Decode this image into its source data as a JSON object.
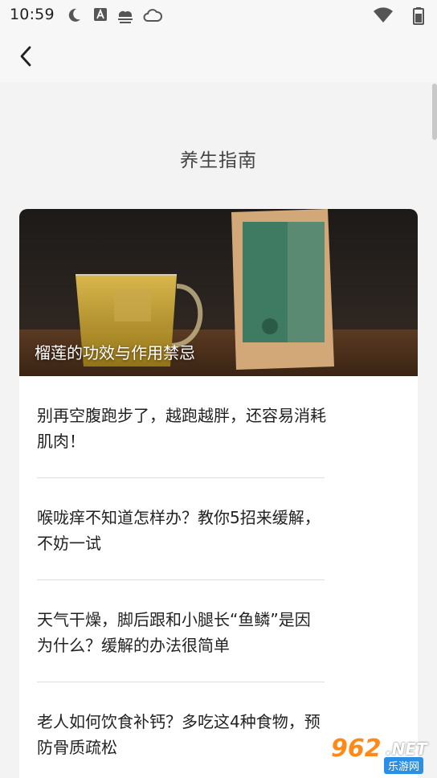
{
  "status_bar": {
    "time": "10:59",
    "icons": [
      "moon-icon",
      "a-badge-icon",
      "weather-icon",
      "cloud-icon",
      "wifi-icon",
      "battery-icon"
    ]
  },
  "app_bar": {
    "back_icon": "chevron-left-icon"
  },
  "page": {
    "title": "养生指南"
  },
  "featured": {
    "caption": "榴莲的功效与作用禁忌"
  },
  "articles": [
    {
      "title": "别再空腹跑步了，越跑越胖，还容易消耗肌肉！"
    },
    {
      "title": "喉咙痒不知道怎样办？教你5招来缓解，不妨一试"
    },
    {
      "title": "天气干燥，脚后跟和小腿长“鱼鳞”是因为什么？缓解的办法很简单"
    },
    {
      "title": "老人如何饮食补钙？多吃这4种食物，预防骨质疏松"
    }
  ],
  "watermark": {
    "number": "962",
    "net": ".NET",
    "sub": "乐游网"
  }
}
